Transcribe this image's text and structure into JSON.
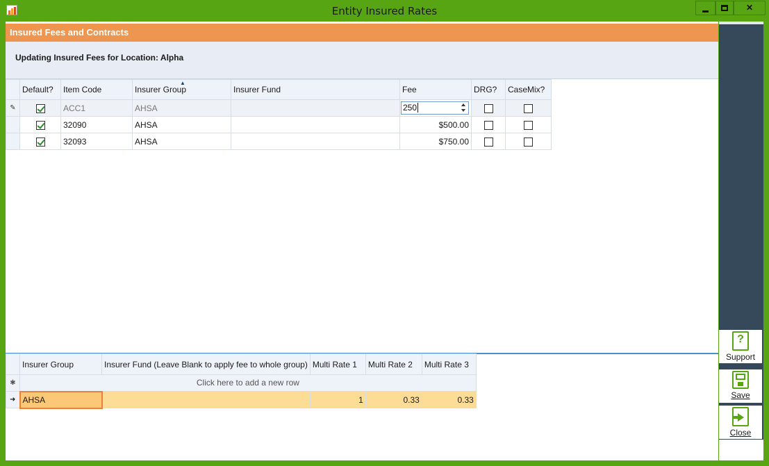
{
  "window": {
    "title": "Entity Insured Rates",
    "buttons": {
      "minimize": "minimize",
      "maximize": "maximize",
      "close": "✕"
    }
  },
  "header": {
    "section_title": "Insured Fees and Contracts",
    "info": "Updating Insured Fees for Location: Alpha"
  },
  "fees_grid": {
    "columns": [
      "Default?",
      "Item Code",
      "Insurer Group",
      "Insurer Fund",
      "Fee",
      "DRG?",
      "CaseMix?"
    ],
    "sorted_column": "Insurer Group",
    "rows": [
      {
        "indicator": "✎",
        "default": true,
        "item_code": "ACC1",
        "insurer_group": "AHSA",
        "insurer_fund": "",
        "fee": "250",
        "drg": false,
        "casemix": false,
        "editing": true
      },
      {
        "indicator": "",
        "default": true,
        "item_code": "32090",
        "insurer_group": "AHSA",
        "insurer_fund": "",
        "fee": "$500.00",
        "drg": false,
        "casemix": false
      },
      {
        "indicator": "",
        "default": true,
        "item_code": "32093",
        "insurer_group": "AHSA",
        "insurer_fund": "",
        "fee": "$750.00",
        "drg": false,
        "casemix": false
      }
    ]
  },
  "multi_rate_grid": {
    "columns": [
      "Insurer Group",
      "Insurer Fund (Leave Blank to apply fee to whole group)",
      "Multi Rate 1",
      "Multi Rate 2",
      "Multi Rate 3"
    ],
    "new_row_indicator": "✱",
    "new_row_text": "Click here to add a new row",
    "rows": [
      {
        "indicator": "➜",
        "insurer_group": "AHSA",
        "insurer_fund": "",
        "multi_rate_1": "1",
        "multi_rate_2": "0.33",
        "multi_rate_3": "0.33"
      }
    ]
  },
  "sidebar": {
    "support_label": "Support",
    "save_label": "Save",
    "close_label": "Close"
  },
  "colors": {
    "window_frame": "#58a514",
    "section_header": "#ee9650",
    "sidebar": "#35495a",
    "selected_row": "#fddc96"
  }
}
